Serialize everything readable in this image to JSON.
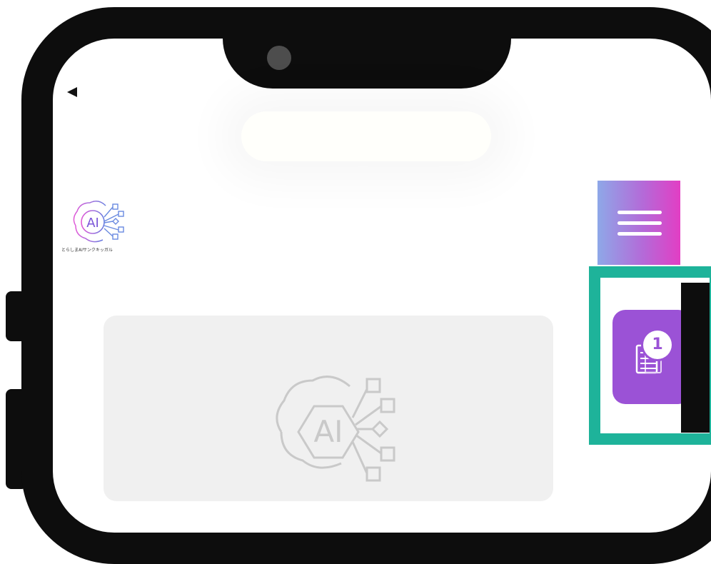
{
  "phone": {
    "back_icon": "back-arrow-icon"
  },
  "header": {
    "logo_text": "とらしまAIサンクキッガル",
    "logo_mark": "AI",
    "menu_icon": "hamburger-icon"
  },
  "floating": {
    "notes_icon": "document-list-icon",
    "badge_count": "1"
  },
  "card": {
    "logo_mark": "AI"
  },
  "colors": {
    "highlight": "#1eb39a",
    "notes_button": "#9b52d6",
    "menu_gradient_start": "#8ea8e8",
    "menu_gradient_end": "#e23ec4"
  }
}
